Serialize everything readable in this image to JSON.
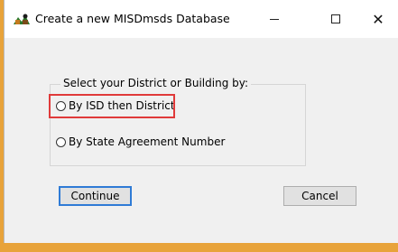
{
  "window": {
    "title": "Create a new MISDmsds Database",
    "icon": "app-logo-icon",
    "controls": {
      "minimize": "minimize-icon",
      "maximize": "maximize-icon",
      "close": "✕"
    }
  },
  "group": {
    "label": "Select your District or Building by:",
    "options": [
      {
        "label": "By ISD then District",
        "selected": false
      },
      {
        "label": "By State Agreement Number",
        "selected": false
      }
    ]
  },
  "buttons": {
    "continue_label": "Continue",
    "cancel_label": "Cancel"
  },
  "colors": {
    "desktop": "#e8a33a",
    "highlight": "#e03a3a",
    "default_button_border": "#2f7bd6"
  }
}
